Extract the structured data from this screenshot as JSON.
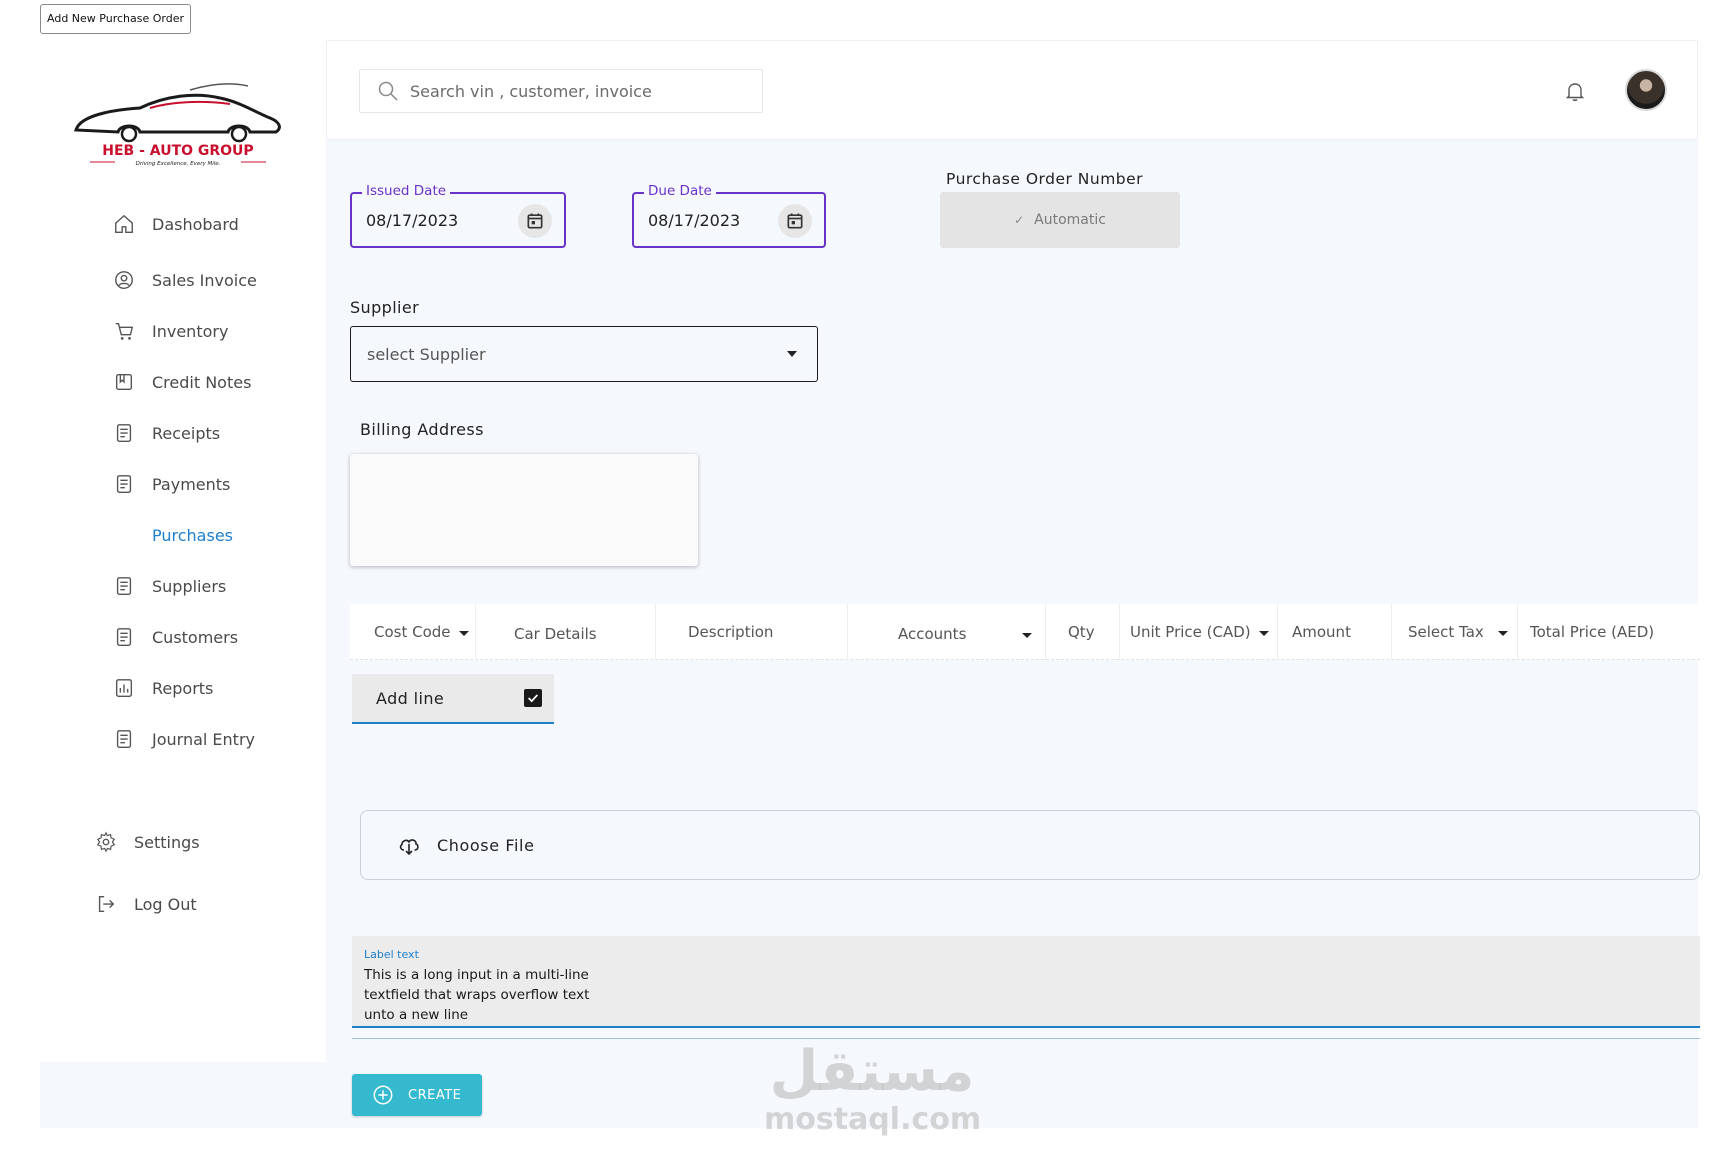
{
  "page_tag": "Add New Purchase Order",
  "brand": {
    "name": "HEB - AUTO GROUP",
    "tagline": "Driving Excellence, Every Mile."
  },
  "sidebar": {
    "items": [
      {
        "label": "Dashobard",
        "icon": "home-icon"
      },
      {
        "label": "Sales Invoice",
        "icon": "user-circle-icon"
      },
      {
        "label": "Inventory",
        "icon": "cart-icon"
      },
      {
        "label": "Credit Notes",
        "icon": "credit-note-icon"
      },
      {
        "label": "Receipts",
        "icon": "document-icon"
      },
      {
        "label": "Payments",
        "icon": "document-icon"
      },
      {
        "label": "Purchases",
        "icon": "document-icon",
        "active": true
      },
      {
        "label": "Suppliers",
        "icon": "document-icon"
      },
      {
        "label": "Customers",
        "icon": "document-icon"
      },
      {
        "label": "Reports",
        "icon": "bar-chart-icon"
      },
      {
        "label": "Journal Entry",
        "icon": "document-icon"
      }
    ],
    "settings": "Settings",
    "logout": "Log Out"
  },
  "topbar": {
    "search_placeholder": "Search vin , customer, invoice"
  },
  "form": {
    "issued_date": {
      "label": "Issued Date",
      "value": "08/17/2023"
    },
    "due_date": {
      "label": "Due Date",
      "value": "08/17/2023"
    },
    "po_number": {
      "label": "Purchase Order Number",
      "value": "Automatic"
    },
    "supplier": {
      "label": "Supplier",
      "placeholder": "select Supplier"
    },
    "billing_address": {
      "label": "Billing Address"
    }
  },
  "lines": {
    "columns": [
      {
        "label": "Cost Code",
        "dropdown": true
      },
      {
        "label": "Car Details",
        "dropdown": false
      },
      {
        "label": "Description",
        "dropdown": false
      },
      {
        "label": "Accounts",
        "dropdown": true
      },
      {
        "label": "Qty",
        "dropdown": false
      },
      {
        "label": "Unit Price (CAD)",
        "dropdown": true
      },
      {
        "label": "Amount",
        "dropdown": false
      },
      {
        "label": "Select Tax",
        "dropdown": true
      },
      {
        "label": "Total Price (AED)",
        "dropdown": false
      }
    ],
    "add_line": "Add line"
  },
  "attachment": {
    "label": "Choose File"
  },
  "notes": {
    "label": "Label text",
    "value": "This is a long input in a multi-line textfield that wraps overflow text unto a new line"
  },
  "actions": {
    "create": "CREATE"
  },
  "watermark": {
    "arabic": "مستقل",
    "latin": "mostaql.com"
  },
  "colors": {
    "accent_purple": "#6a32c9",
    "accent_blue": "#1e7fcb",
    "create_button": "#35b9cf",
    "main_bg": "#f5f9fd"
  }
}
